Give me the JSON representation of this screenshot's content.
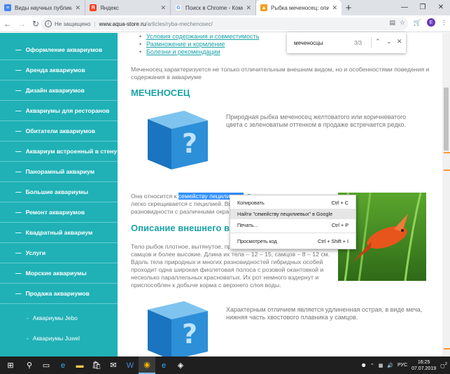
{
  "browser": {
    "tabs": [
      {
        "title": "Виды научных публикаций",
        "favicon": "docs-icon",
        "color": "#4285f4",
        "active": false
      },
      {
        "title": "Яндекс",
        "favicon": "yandex-icon",
        "color": "#fc3f1d",
        "active": false
      },
      {
        "title": "Поиск в Chrome - Компьютер",
        "favicon": "google-icon",
        "color": "#34a853",
        "active": false
      },
      {
        "title": "Рыбка меченосец: описание, с",
        "favicon": "aqua-store-icon",
        "color": "#f4a020",
        "active": true
      }
    ],
    "url_security": "Не защищено",
    "url_host": "www.aqua-store.ru",
    "url_path": "/articles/ryba-mechenosec/",
    "profile_letter": "E"
  },
  "find_bar": {
    "query": "меченосцы",
    "count": "3/3"
  },
  "sidebar": {
    "items": [
      {
        "label": "Оформление аквариумов"
      },
      {
        "label": "Аренда аквариумов"
      },
      {
        "label": "Дизайн аквариумов"
      },
      {
        "label": "Аквариумы для ресторанов"
      },
      {
        "label": "Обитатели аквариумов"
      },
      {
        "label": "Аквариум встроенный в стену"
      },
      {
        "label": "Панорамный аквариум"
      },
      {
        "label": "Большие аквариумы"
      },
      {
        "label": "Ремонт аквариумов"
      },
      {
        "label": "Квадратный аквариум"
      },
      {
        "label": "Услуги"
      },
      {
        "label": "Морские аквариумы"
      },
      {
        "label": "Продажа аквариумов"
      }
    ],
    "subitems": [
      {
        "label": "Аквариумы Jebo"
      },
      {
        "label": "Аквариумы Juwel"
      }
    ]
  },
  "article": {
    "links": [
      "Условия содержания и совместимость",
      "Размножение и кормление",
      "Болезни и рекомендации"
    ],
    "intro_1": "Меченосец характеризуется не только отличительным внешним видом, но и особенностями поведения и",
    "intro_2": "содержания в аквариуме",
    "heading_main": "МЕЧЕНОСЕЦ",
    "box1_line1": "Природная рыбка меченосец желтоватого или коричневатого",
    "box1_line2": "цвета с зеленоватым оттенком в продаже встречается редко.",
    "p2_pre": "Она относится к ",
    "p2_highlight": "семейству пецилиевых",
    "p2_post": ". В аквариумных условиях",
    "p2_line2": "легко скрещивается с пецилией. Вы",
    "p2_line3": "разновидности с различными окра",
    "heading_desc": "Описание внешнего вида",
    "desc_1": "Тело рыбок плотное, вытянутое, приплюснутое с боков. Самки крупнее",
    "desc_2": "самцов и более высокие. Длина их тела – 12 – 15, самцов – 8 – 12 см.",
    "desc_3": "Вдоль тела природных и многих разновидностей гибридных особей",
    "desc_4": "проходит одна широкая фиолетовая полоса с розовой окантовкой и",
    "desc_5": "несколько параллельных красноватых. Их рот немного вздернут и",
    "desc_6": "приспособлен к добыче корма с верхнего слоя воды.",
    "box2_line1": "Характерным отличием является удлиненная острая, в виде меча,",
    "box2_line2": "нижняя часть хвостового плавника у самцов."
  },
  "context_menu": {
    "items": [
      {
        "label": "Копировать",
        "shortcut": "Ctrl + C"
      },
      {
        "label": "Найти \"семейству пецилиевых\" в Google",
        "shortcut": ""
      },
      {
        "label": "Печать...",
        "shortcut": "Ctrl + P"
      },
      {
        "label": "Просмотреть код",
        "shortcut": "Ctrl + Shift + I"
      }
    ]
  },
  "taskbar": {
    "lang": "РУС",
    "time": "16:25",
    "date": "07.07.2019",
    "notifications": "2"
  },
  "colors": {
    "accent": "#1fb1b6",
    "link": "#1aa3a8",
    "selection": "#3390ff"
  }
}
